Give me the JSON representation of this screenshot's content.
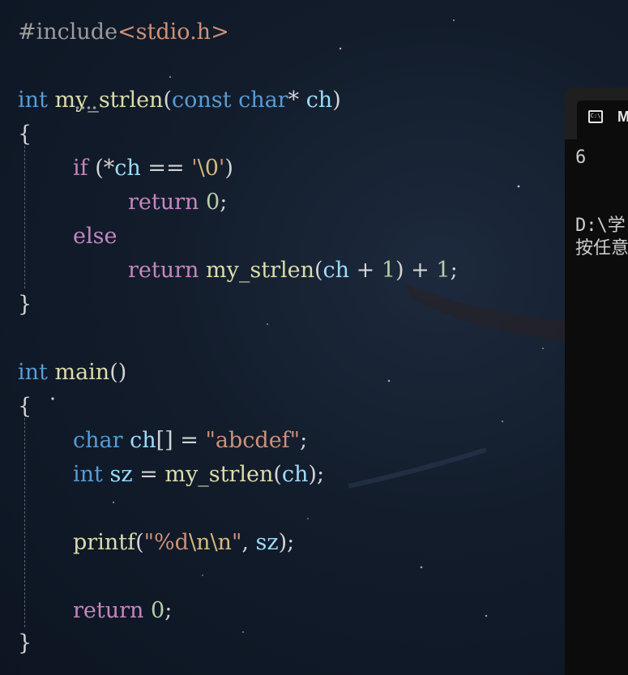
{
  "editor": {
    "code": {
      "include_directive": "#include",
      "include_header": "<stdio.h>",
      "l3_type": "int",
      "l3_func": "my_strlen",
      "l3_open": "(",
      "l3_const": "const",
      "l3_char": "char",
      "l3_star": "* ",
      "l3_param": "ch",
      "l3_close": ")",
      "brace_open": "{",
      "brace_close": "}",
      "if_kw": "if",
      "if_paren": " (",
      "if_star": "*",
      "if_ch": "ch",
      "if_eq": " == ",
      "if_quote_open": "'",
      "if_escape": "\\0",
      "if_quote_close": "'",
      "if_close": ")",
      "return_kw": "return",
      "zero": "0",
      "semicolon": ";",
      "else_kw": "else",
      "rec_func": "my_strlen",
      "rec_open": "(",
      "rec_ch": "ch",
      "rec_plus1": " + ",
      "rec_one": "1",
      "rec_close": ")",
      "rec_plus2": " + ",
      "rec_one2": "1",
      "main_type": "int",
      "main_func": "main",
      "main_parens": "()",
      "decl_char": "char",
      "decl_var": "ch",
      "decl_brackets": "[] = ",
      "decl_str": "\"abcdef\"",
      "sz_type": "int",
      "sz_var": "sz",
      "sz_eq": " = ",
      "sz_func": "my_strlen",
      "sz_open": "(",
      "sz_arg": "ch",
      "sz_close": ");",
      "printf_func": "printf",
      "printf_open": "(",
      "printf_fmt1": "\"%d",
      "printf_esc": "\\n\\n",
      "printf_fmt2": "\"",
      "printf_comma": ", ",
      "printf_arg": "sz",
      "printf_close": ");",
      "main_return": "return",
      "main_zero": "0",
      "main_semi": ";"
    }
  },
  "terminal": {
    "tab_icon": "C:\\",
    "tab_title": "M",
    "output_line1": "6",
    "output_line2": "D:\\学",
    "output_line3": "按任意"
  },
  "colors": {
    "keyword_blue": "#569cd6",
    "keyword_pink": "#c586c0",
    "function": "#dcdcaa",
    "variable": "#9cdcfe",
    "string": "#ce9178",
    "number": "#b5cea8",
    "background": "#121c2b"
  }
}
